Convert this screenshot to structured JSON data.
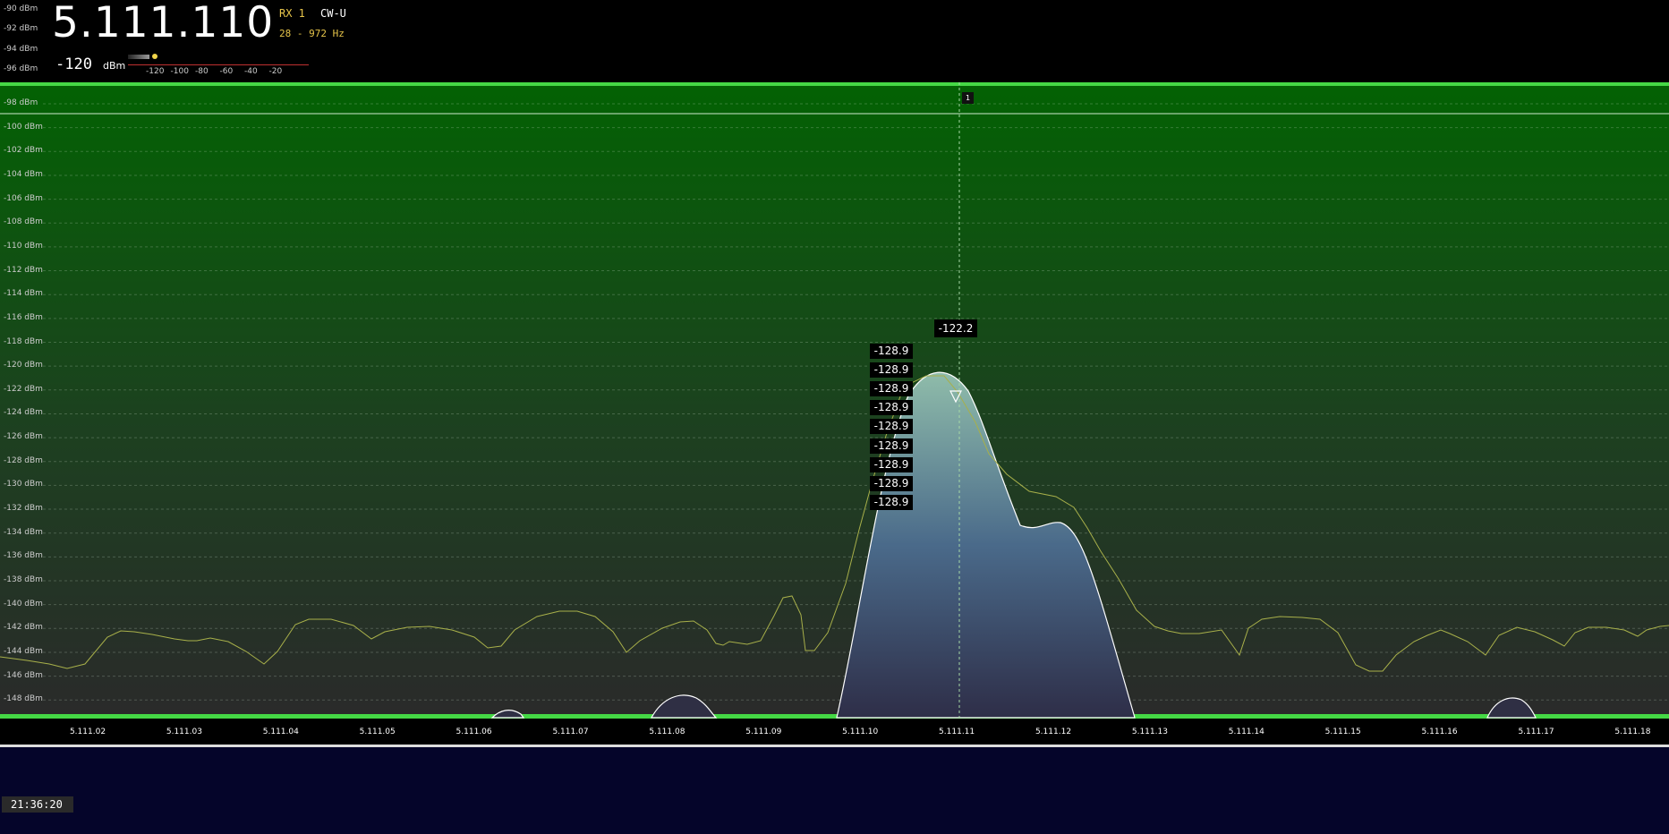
{
  "header": {
    "frequency": "5.111.110",
    "rx": "RX 1",
    "mode": "CW-U",
    "bandwidth": "28 - 972 Hz",
    "signal_value": "-120",
    "signal_unit": "dBm",
    "meter_ticks": [
      "-120",
      "-100",
      "-80",
      "-60",
      "-40",
      "-20"
    ]
  },
  "y_labels_top": [
    "-90 dBm",
    "-92 dBm",
    "-94 dBm",
    "-96 dBm"
  ],
  "y_labels": [
    "-98 dBm",
    "-100 dBm",
    "-102 dBm",
    "-104 dBm",
    "-106 dBm",
    "-108 dBm",
    "-110 dBm",
    "-112 dBm",
    "-114 dBm",
    "-116 dBm",
    "-118 dBm",
    "-120 dBm",
    "-122 dBm",
    "-124 dBm",
    "-126 dBm",
    "-128 dBm",
    "-130 dBm",
    "-132 dBm",
    "-134 dBm",
    "-136 dBm",
    "-138 dBm",
    "-140 dBm",
    "-142 dBm",
    "-144 dBm",
    "-146 dBm",
    "-148 dBm"
  ],
  "x_labels": [
    "5.111.02",
    "5.111.03",
    "5.111.04",
    "5.111.05",
    "5.111.06",
    "5.111.07",
    "5.111.08",
    "5.111.09",
    "5.111.10",
    "5.111.11",
    "5.111.12",
    "5.111.13",
    "5.111.14",
    "5.111.15",
    "5.111.16",
    "5.111.17",
    "5.111.18"
  ],
  "peak_label": "-122.2",
  "level_labels": [
    "-128.9",
    "-128.9",
    "-128.9",
    "-128.9",
    "-128.9",
    "-128.9",
    "-128.9",
    "-128.9",
    "-128.9"
  ],
  "marker": "1",
  "clock": "21:36:20",
  "colors": {
    "accent_green": "#45d845",
    "signal_fill": "#6e9aa4",
    "trace": "#9aa84a",
    "waterfall": "#05052a"
  }
}
